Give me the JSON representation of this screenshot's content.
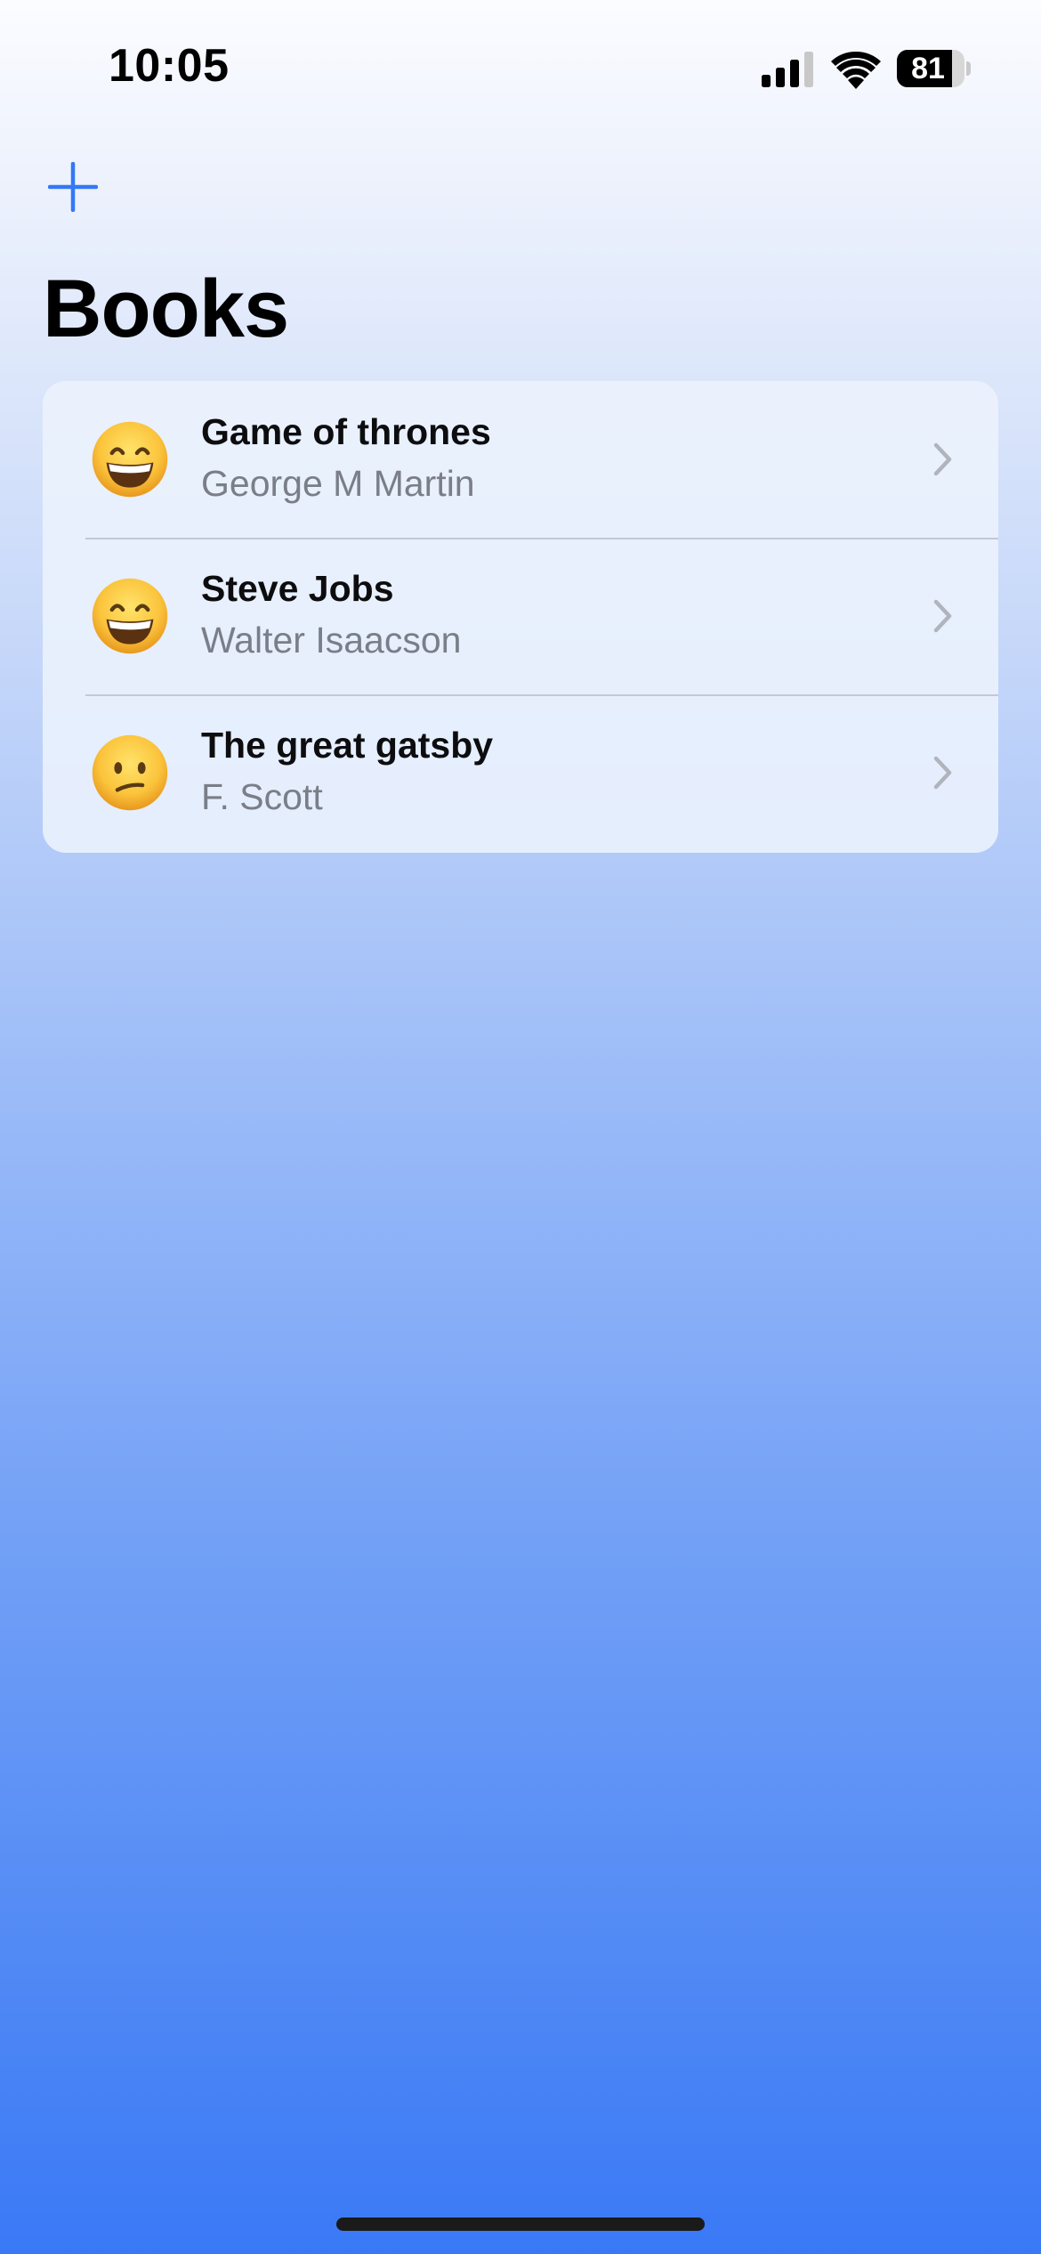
{
  "status_bar": {
    "time": "10:05",
    "battery_percent": "81",
    "battery_level": 0.81,
    "signal_icon": "cellular-signal-icon",
    "wifi_icon": "wifi-icon"
  },
  "nav": {
    "add_icon": "plus-icon",
    "title": "Books"
  },
  "books": [
    {
      "title": "Game of thrones",
      "author": "George M Martin",
      "emoji": "grinning-face-icon"
    },
    {
      "title": "Steve Jobs",
      "author": "Walter Isaacson",
      "emoji": "grinning-face-icon"
    },
    {
      "title": "The great gatsby",
      "author": "F. Scott",
      "emoji": "confused-face-icon"
    }
  ],
  "colors": {
    "accent": "#3478f6",
    "chevron": "#b0b4bc",
    "subtitle": "#7a7e88"
  }
}
